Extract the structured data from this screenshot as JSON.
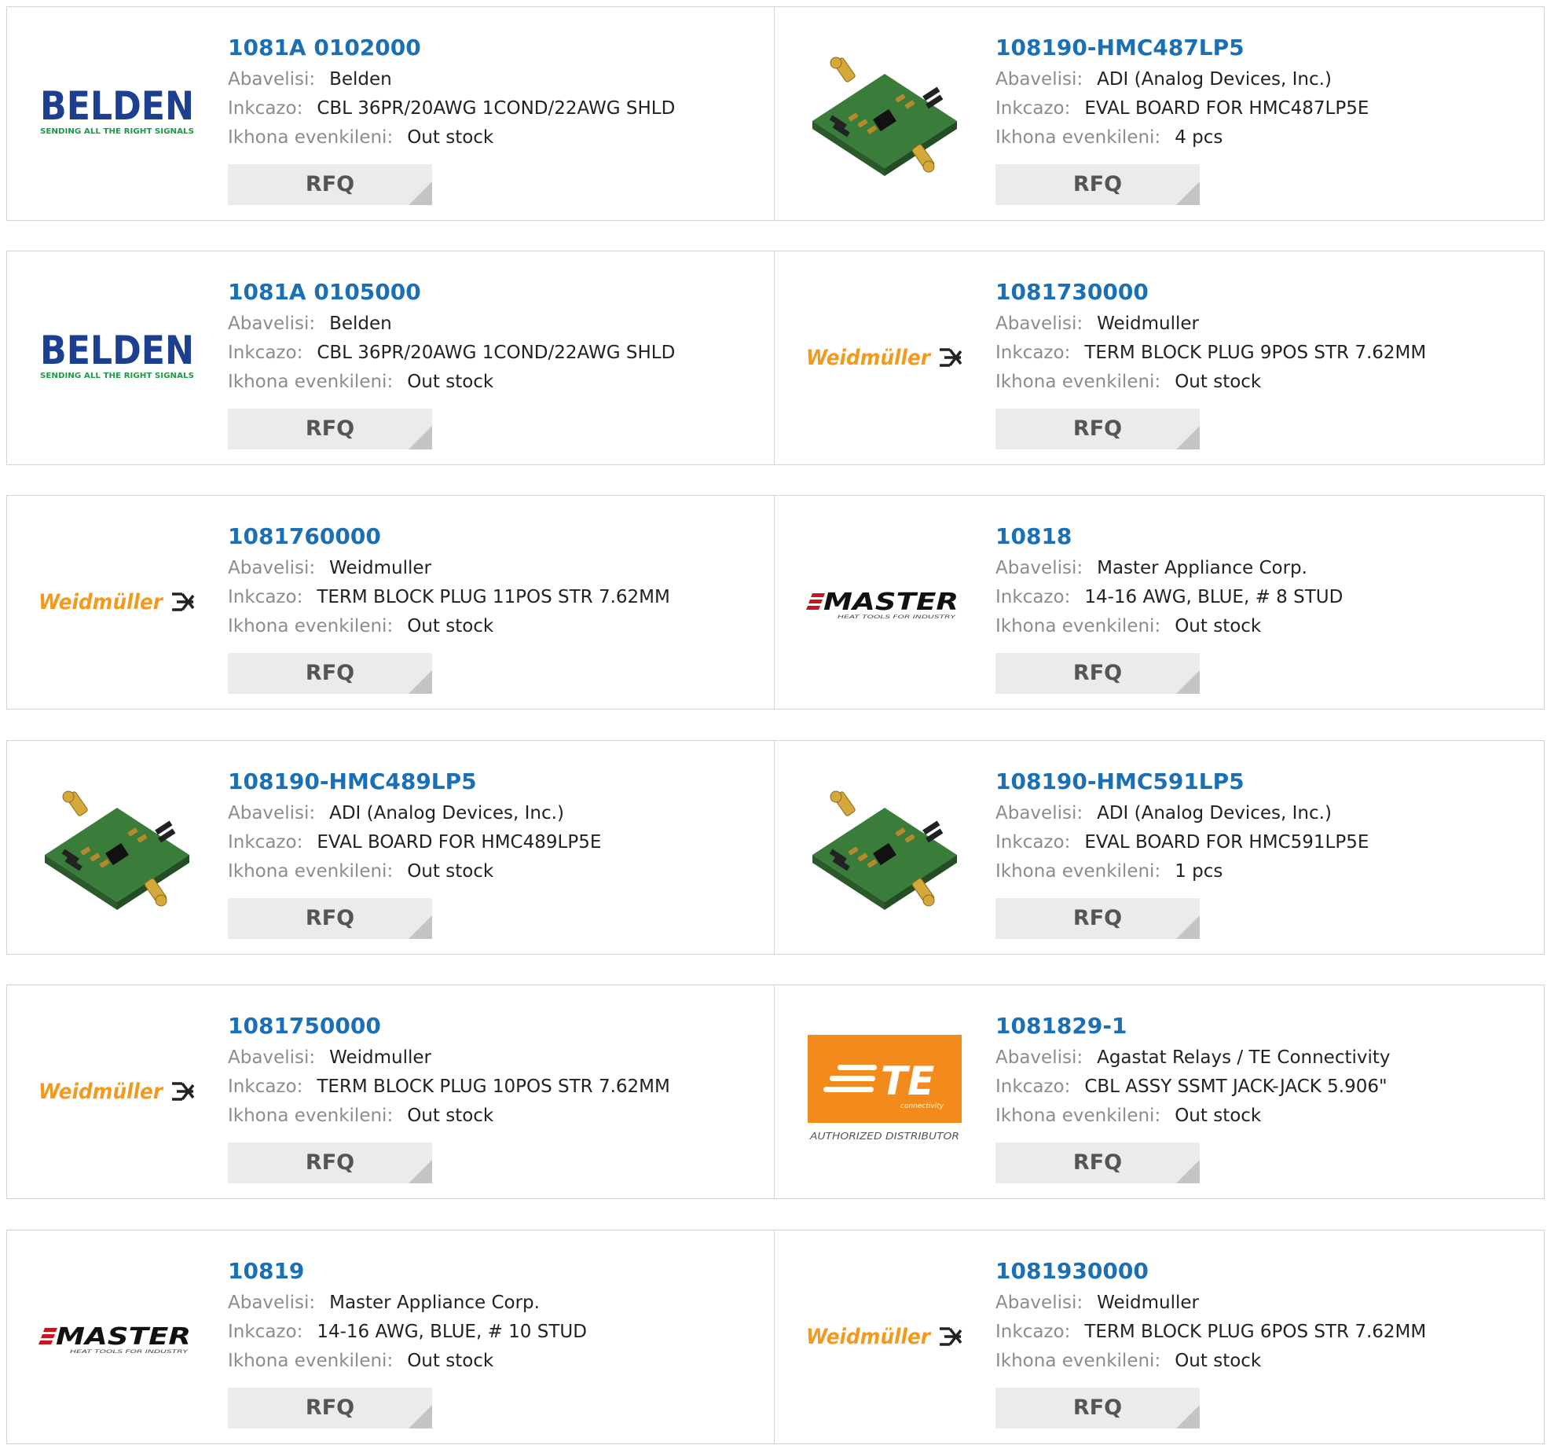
{
  "labels": {
    "manufacturer": "Abavelisi:",
    "description": "Inkcazo:",
    "stock": "Ikhona evenkileni:",
    "rfq": "RFQ"
  },
  "colors": {
    "link": "#1a6fb5",
    "label": "#8c8c8c",
    "button_bg": "#ebebeb",
    "border": "#d3d3d3",
    "belden_blue": "#1d3f8f",
    "belden_green": "#1c9a47",
    "weidmuller_orange": "#f39a1e",
    "te_orange": "#f28a1c"
  },
  "logo_text": {
    "belden": {
      "name": "BELDEN",
      "tagline": "SENDING ALL THE RIGHT SIGNALS"
    },
    "weidmuller": {
      "name": "Weidmüller"
    },
    "master": {
      "name": "MASTER",
      "tagline": "HEAT TOOLS FOR INDUSTRY"
    },
    "te": {
      "name": "TE",
      "sub": "connectivity",
      "caption": "AUTHORIZED DISTRIBUTOR"
    }
  },
  "products": [
    {
      "part_number": "1081A 0102000",
      "manufacturer": "Belden",
      "description": "CBL 36PR/20AWG 1COND/22AWG SHLD",
      "stock": "Out stock",
      "logo": "belden"
    },
    {
      "part_number": "108190-HMC487LP5",
      "manufacturer": "ADI (Analog Devices, Inc.)",
      "description": "EVAL BOARD FOR HMC487LP5E",
      "stock": "4 pcs",
      "logo": "eval-board"
    },
    {
      "part_number": "1081A 0105000",
      "manufacturer": "Belden",
      "description": "CBL 36PR/20AWG 1COND/22AWG SHLD",
      "stock": "Out stock",
      "logo": "belden"
    },
    {
      "part_number": "1081730000",
      "manufacturer": "Weidmuller",
      "description": "TERM BLOCK PLUG 9POS STR 7.62MM",
      "stock": "Out stock",
      "logo": "weidmuller"
    },
    {
      "part_number": "1081760000",
      "manufacturer": "Weidmuller",
      "description": "TERM BLOCK PLUG 11POS STR 7.62MM",
      "stock": "Out stock",
      "logo": "weidmuller"
    },
    {
      "part_number": "10818",
      "manufacturer": "Master Appliance Corp.",
      "description": "14-16 AWG, BLUE, # 8 STUD",
      "stock": "Out stock",
      "logo": "master"
    },
    {
      "part_number": "108190-HMC489LP5",
      "manufacturer": "ADI (Analog Devices, Inc.)",
      "description": "EVAL BOARD FOR HMC489LP5E",
      "stock": "Out stock",
      "logo": "eval-board"
    },
    {
      "part_number": "108190-HMC591LP5",
      "manufacturer": "ADI (Analog Devices, Inc.)",
      "description": "EVAL BOARD FOR HMC591LP5E",
      "stock": "1 pcs",
      "logo": "eval-board"
    },
    {
      "part_number": "1081750000",
      "manufacturer": "Weidmuller",
      "description": "TERM BLOCK PLUG 10POS STR 7.62MM",
      "stock": "Out stock",
      "logo": "weidmuller"
    },
    {
      "part_number": "1081829-1",
      "manufacturer": "Agastat Relays / TE Connectivity",
      "description": "CBL ASSY SSMT JACK-JACK 5.906\"",
      "stock": "Out stock",
      "logo": "te"
    },
    {
      "part_number": "10819",
      "manufacturer": "Master Appliance Corp.",
      "description": "14-16 AWG, BLUE, # 10 STUD",
      "stock": "Out stock",
      "logo": "master"
    },
    {
      "part_number": "1081930000",
      "manufacturer": "Weidmuller",
      "description": "TERM BLOCK PLUG 6POS STR 7.62MM",
      "stock": "Out stock",
      "logo": "weidmuller"
    }
  ]
}
